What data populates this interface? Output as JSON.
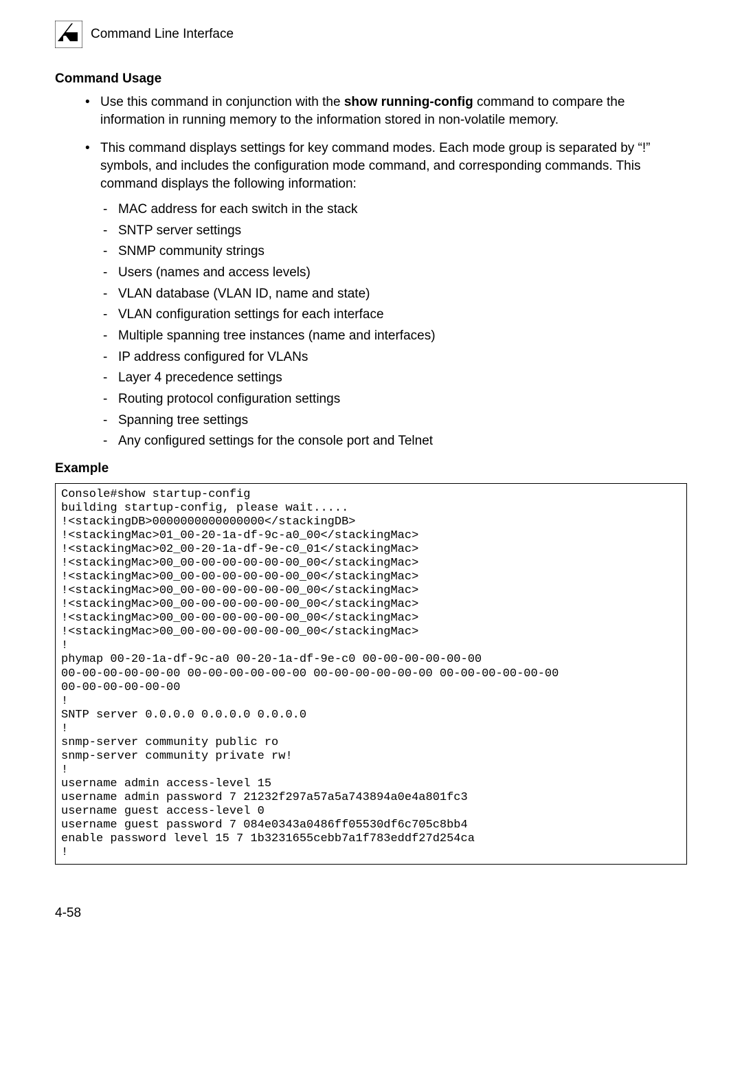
{
  "header": {
    "title": "Command Line Interface",
    "chapter_number": "4"
  },
  "sections": {
    "command_usage_heading": "Command Usage",
    "bullet1_pre": "Use this command in conjunction with the ",
    "bullet1_bold": "show running-config",
    "bullet1_post": " command to compare the information in running memory to the information stored in non-volatile memory.",
    "bullet2": "This command displays settings for key command modes. Each mode group is separated by “!” symbols, and includes the configuration mode command, and corresponding commands. This command displays the following information:",
    "sub_items": [
      "MAC address for each switch in the stack",
      "SNTP server settings",
      "SNMP community strings",
      "Users (names and access levels)",
      "VLAN database (VLAN ID, name and state)",
      "VLAN configuration settings for each interface",
      "Multiple spanning tree instances (name and interfaces)",
      "IP address configured for VLANs",
      "Layer 4 precedence settings",
      "Routing protocol configuration settings",
      "Spanning tree settings",
      "Any configured settings for the console port and Telnet"
    ],
    "example_heading": "Example",
    "example_code": "Console#show startup-config\nbuilding startup-config, please wait.....\n!<stackingDB>0000000000000000</stackingDB>\n!<stackingMac>01_00-20-1a-df-9c-a0_00</stackingMac>\n!<stackingMac>02_00-20-1a-df-9e-c0_01</stackingMac>\n!<stackingMac>00_00-00-00-00-00-00_00</stackingMac>\n!<stackingMac>00_00-00-00-00-00-00_00</stackingMac>\n!<stackingMac>00_00-00-00-00-00-00_00</stackingMac>\n!<stackingMac>00_00-00-00-00-00-00_00</stackingMac>\n!<stackingMac>00_00-00-00-00-00-00_00</stackingMac>\n!<stackingMac>00_00-00-00-00-00-00_00</stackingMac>\n!\nphymap 00-20-1a-df-9c-a0 00-20-1a-df-9e-c0 00-00-00-00-00-00 \n00-00-00-00-00-00 00-00-00-00-00-00 00-00-00-00-00-00 00-00-00-00-00-00 \n00-00-00-00-00-00\n!\nSNTP server 0.0.0.0 0.0.0.0 0.0.0.0\n!\nsnmp-server community public ro\nsnmp-server community private rw!\n!\nusername admin access-level 15\nusername admin password 7 21232f297a57a5a743894a0e4a801fc3\nusername guest access-level 0\nusername guest password 7 084e0343a0486ff05530df6c705c8bb4\nenable password level 15 7 1b3231655cebb7a1f783eddf27d254ca\n!"
  },
  "page_number": "4-58"
}
